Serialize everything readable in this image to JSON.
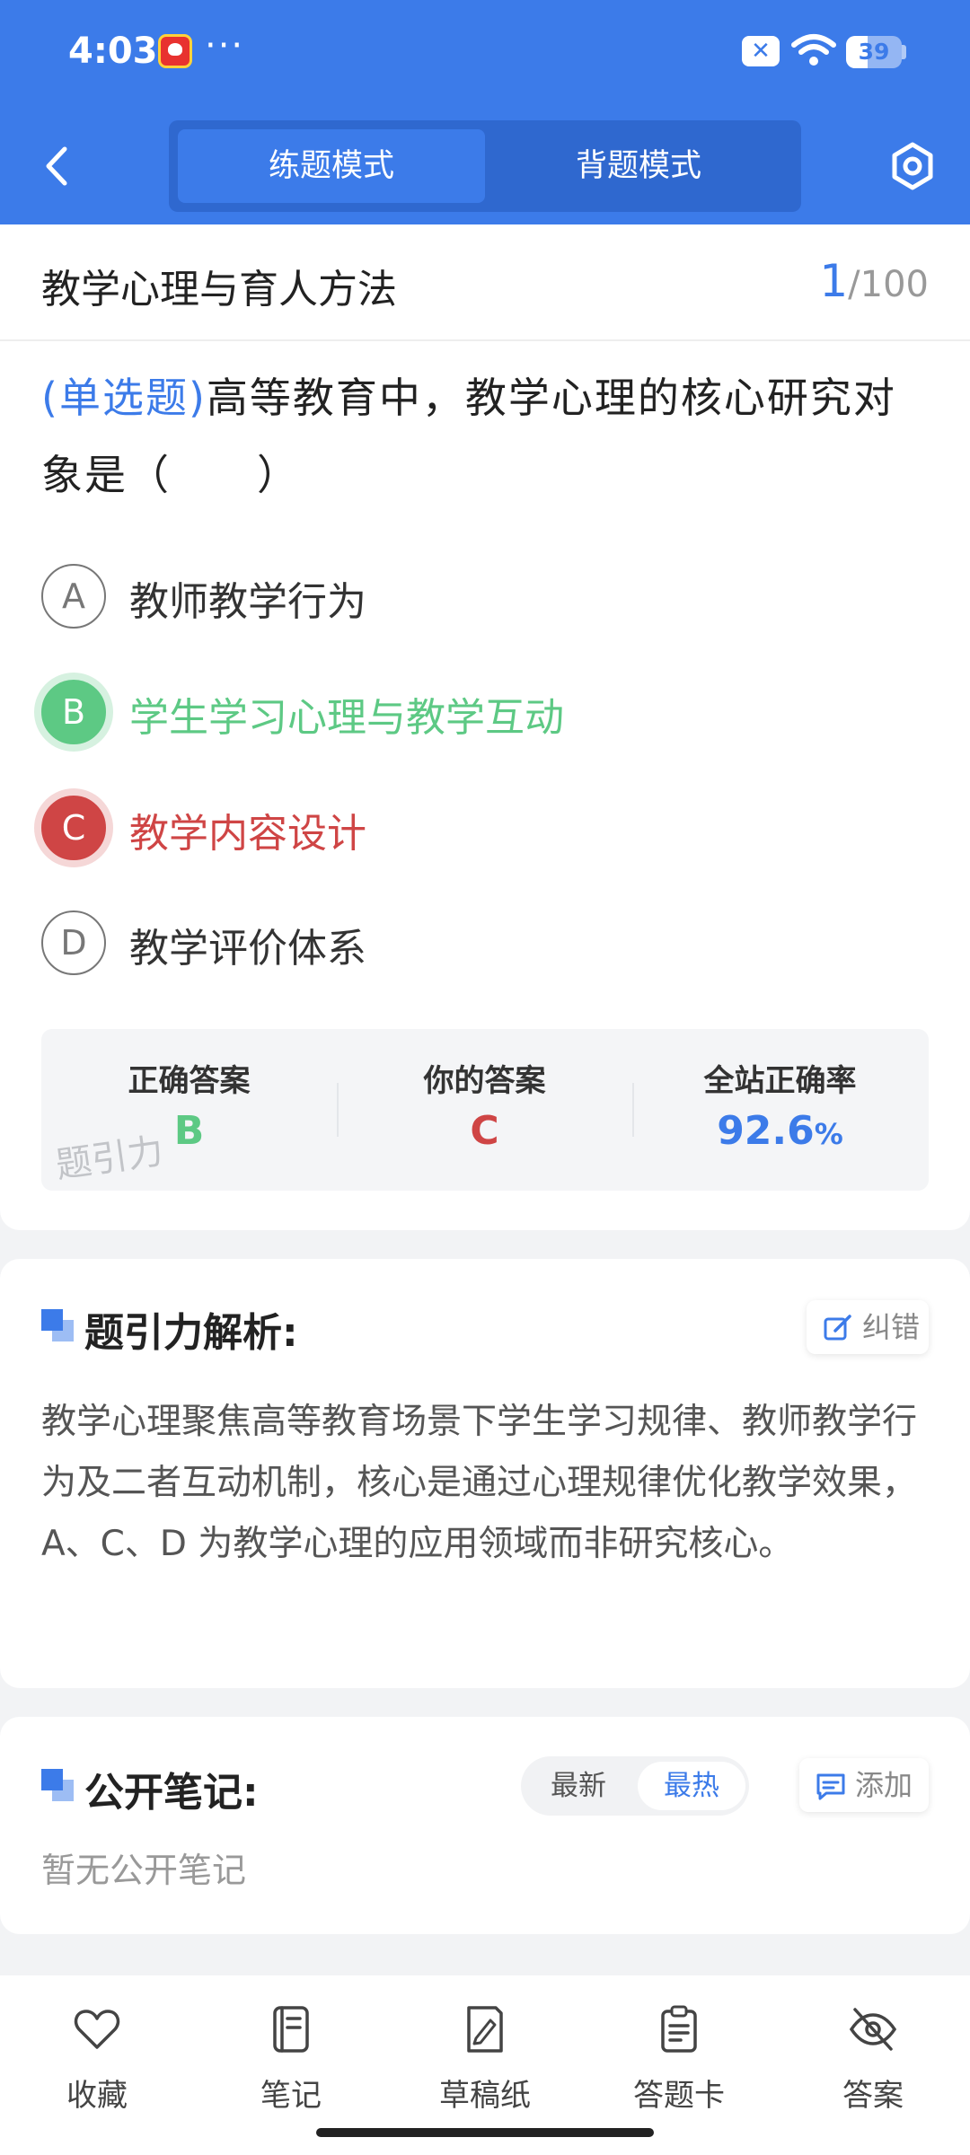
{
  "status_bar": {
    "time": "4:03",
    "more": "···",
    "battery_level": "39",
    "battery_fraction": 0.39
  },
  "header": {
    "tabs": [
      {
        "label": "练题模式",
        "active": true
      },
      {
        "label": "背题模式",
        "active": false
      }
    ]
  },
  "chapter": {
    "title": "教学心理与育人方法",
    "current": "1",
    "total": "/100"
  },
  "question": {
    "type": "(单选题)",
    "text": "高等教育中，教学心理的核心研究对象是（　　）"
  },
  "options": [
    {
      "letter": "A",
      "text": "教师教学行为",
      "state": "normal"
    },
    {
      "letter": "B",
      "text": "学生学习心理与教学互动",
      "state": "correct"
    },
    {
      "letter": "C",
      "text": "教学内容设计",
      "state": "wrong"
    },
    {
      "letter": "D",
      "text": "教学评价体系",
      "state": "normal"
    }
  ],
  "answer_summary": {
    "correct_label": "正确答案",
    "correct_value": "B",
    "yours_label": "你的答案",
    "yours_value": "C",
    "rate_label": "全站正确率",
    "rate_value": "92.6",
    "rate_unit": "%",
    "watermark": "题引力"
  },
  "analysis": {
    "title": "题引力解析:",
    "report_label": "纠错",
    "text": "教学心理聚焦高等教育场景下学生学习规律、教师教学行为及二者互动机制，核心是通过心理规律优化教学效果，A、C、D 为教学心理的应用领域而非研究核心。"
  },
  "notes": {
    "title": "公开笔记:",
    "sort_latest": "最新",
    "sort_hot": "最热",
    "add_label": "添加",
    "empty_text": "暂无公开笔记"
  },
  "bottom_nav": [
    {
      "label": "收藏",
      "icon": "heart-icon"
    },
    {
      "label": "笔记",
      "icon": "notebook-icon"
    },
    {
      "label": "草稿纸",
      "icon": "draft-pen-icon"
    },
    {
      "label": "答题卡",
      "icon": "answer-card-icon"
    },
    {
      "label": "答案",
      "icon": "eye-off-icon"
    }
  ],
  "colors": {
    "primary": "#3c7be9",
    "correct": "#5dc984",
    "wrong": "#cf4545"
  }
}
